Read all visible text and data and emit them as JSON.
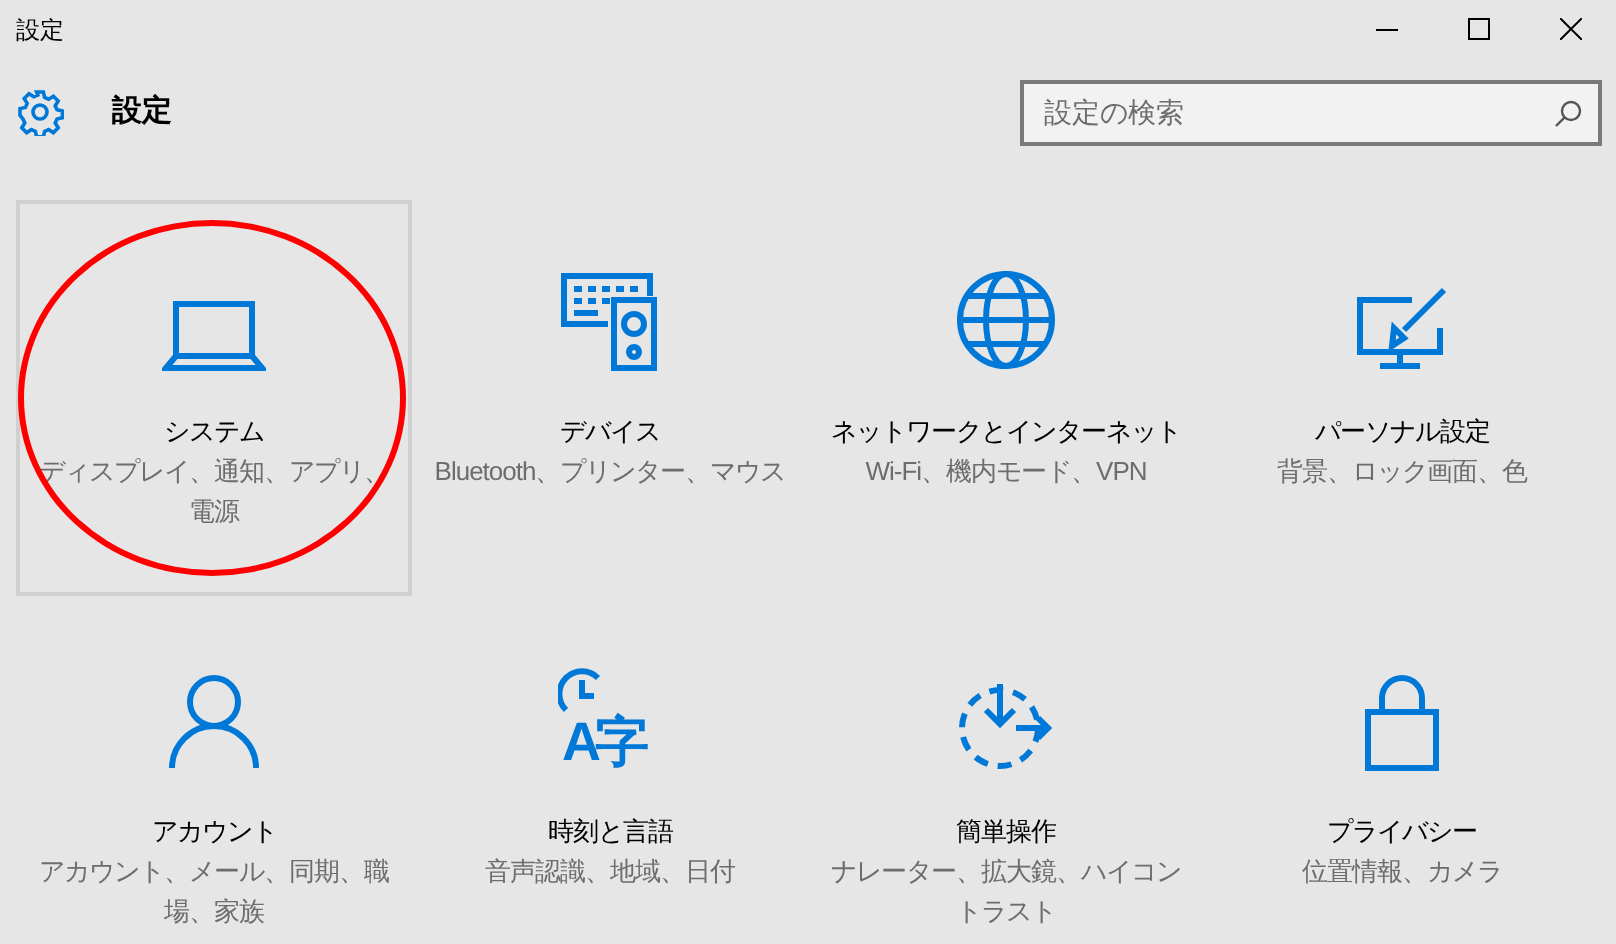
{
  "window": {
    "title": "設定"
  },
  "header": {
    "title": "設定"
  },
  "search": {
    "placeholder": "設定の検索"
  },
  "tiles": [
    {
      "kind": "laptop",
      "title": "システム",
      "description": "ディスプレイ、通知、アプリ、電源",
      "selected": true,
      "circled": true
    },
    {
      "kind": "devices",
      "title": "デバイス",
      "description": "Bluetooth、プリンター、マウス",
      "selected": false,
      "circled": false
    },
    {
      "kind": "globe",
      "title": "ネットワークとインターネット",
      "description": "Wi-Fi、機内モード、VPN",
      "selected": false,
      "circled": false
    },
    {
      "kind": "personalize",
      "title": "パーソナル設定",
      "description": "背景、ロック画面、色",
      "selected": false,
      "circled": false
    },
    {
      "kind": "person",
      "title": "アカウント",
      "description": "アカウント、メール、同期、職場、家族",
      "selected": false,
      "circled": false
    },
    {
      "kind": "time",
      "icon_text": "A字",
      "title": "時刻と言語",
      "description": "音声認識、地域、日付",
      "selected": false,
      "circled": false
    },
    {
      "kind": "ease",
      "title": "簡単操作",
      "description": "ナレーター、拡大鏡、ハイコントラスト",
      "selected": false,
      "circled": false
    },
    {
      "kind": "lock",
      "title": "プライバシー",
      "description": "位置情報、カメラ",
      "selected": false,
      "circled": false
    }
  ]
}
